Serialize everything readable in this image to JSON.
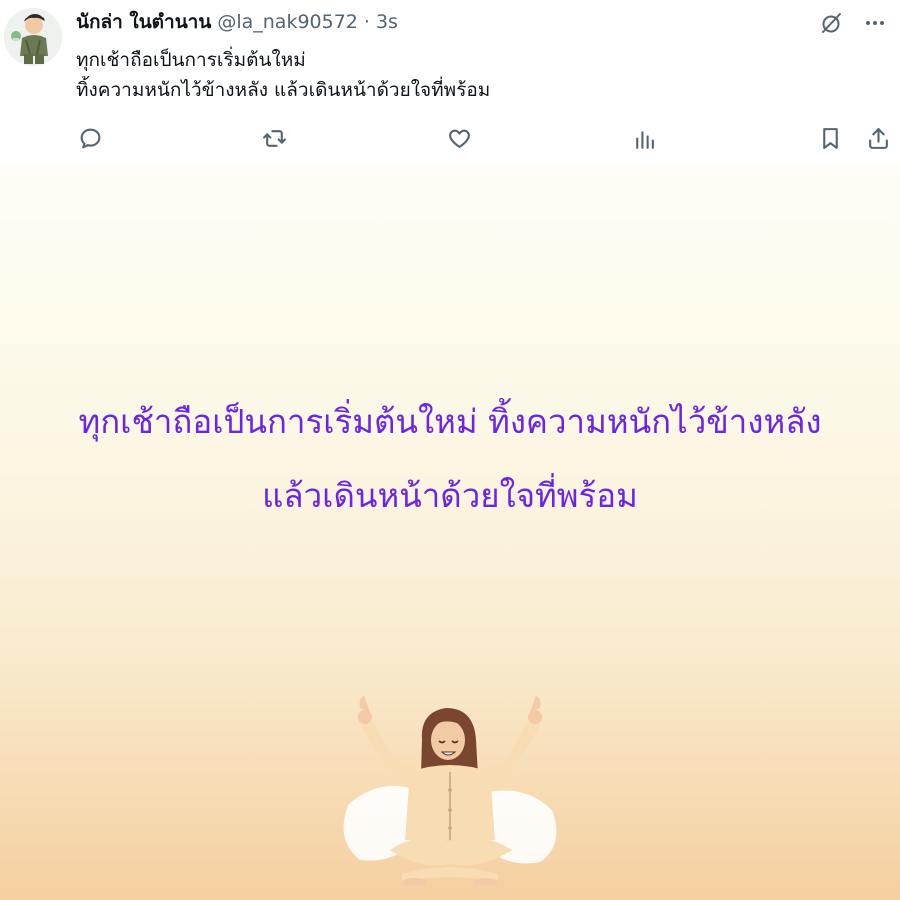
{
  "post": {
    "display_name": "นักล่า ในตำนาน",
    "handle": "@la_nak90572",
    "separator": "·",
    "time": "3s",
    "text_lines": [
      "ทุกเช้าถือเป็นการเริ่มต้นใหม่",
      "ทิ้งความหนักไว้ข้างหลัง แล้วเดินหน้าด้วยใจที่พร้อม"
    ]
  },
  "media": {
    "text_lines": [
      "ทุกเช้าถือเป็นการเริ่มต้นใหม่ ทิ้งความหนักไว้ข้างหลัง",
      "แล้วเดินหน้าด้วยใจที่พร้อม"
    ]
  },
  "icons": {
    "top": [
      "grok-icon",
      "more-icon"
    ],
    "actions": [
      "reply-icon",
      "repost-icon",
      "like-icon",
      "views-icon",
      "bookmark-icon",
      "share-icon"
    ]
  },
  "colors": {
    "media_text": "#6a25e8",
    "secondary_text": "#536471",
    "icon": "#536471"
  }
}
